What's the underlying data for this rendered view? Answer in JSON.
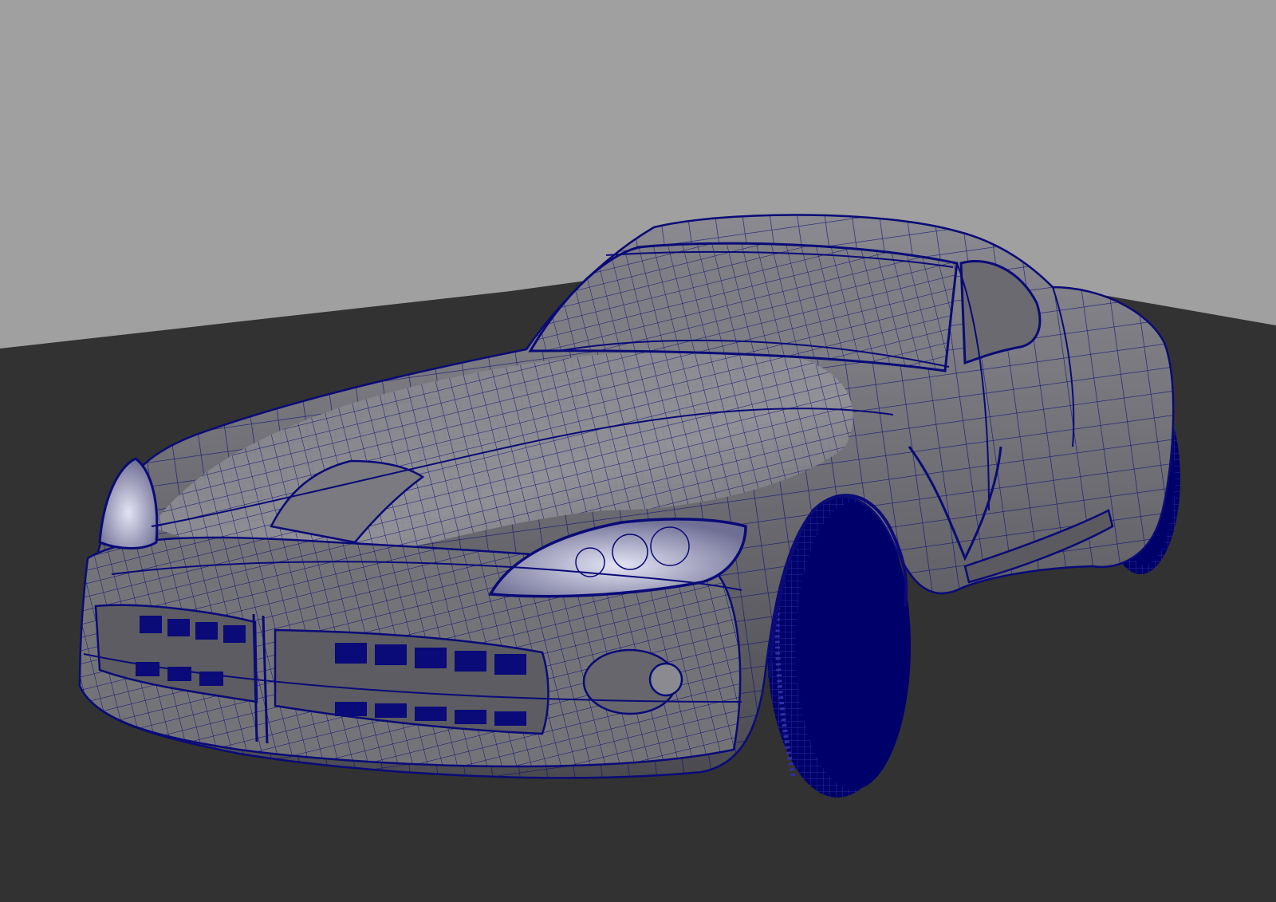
{
  "viewport": {
    "display_mode": "wireframe-on-shaded",
    "colors": {
      "background": "#a0a0a0",
      "ground_plane": "#323232",
      "model_shaded": "#6e6e72",
      "model_highlight": "#9a9aa0",
      "wireframe": "#0a0a78",
      "tire": "#00006a",
      "headlight_glow": "#c8c8e6"
    }
  }
}
